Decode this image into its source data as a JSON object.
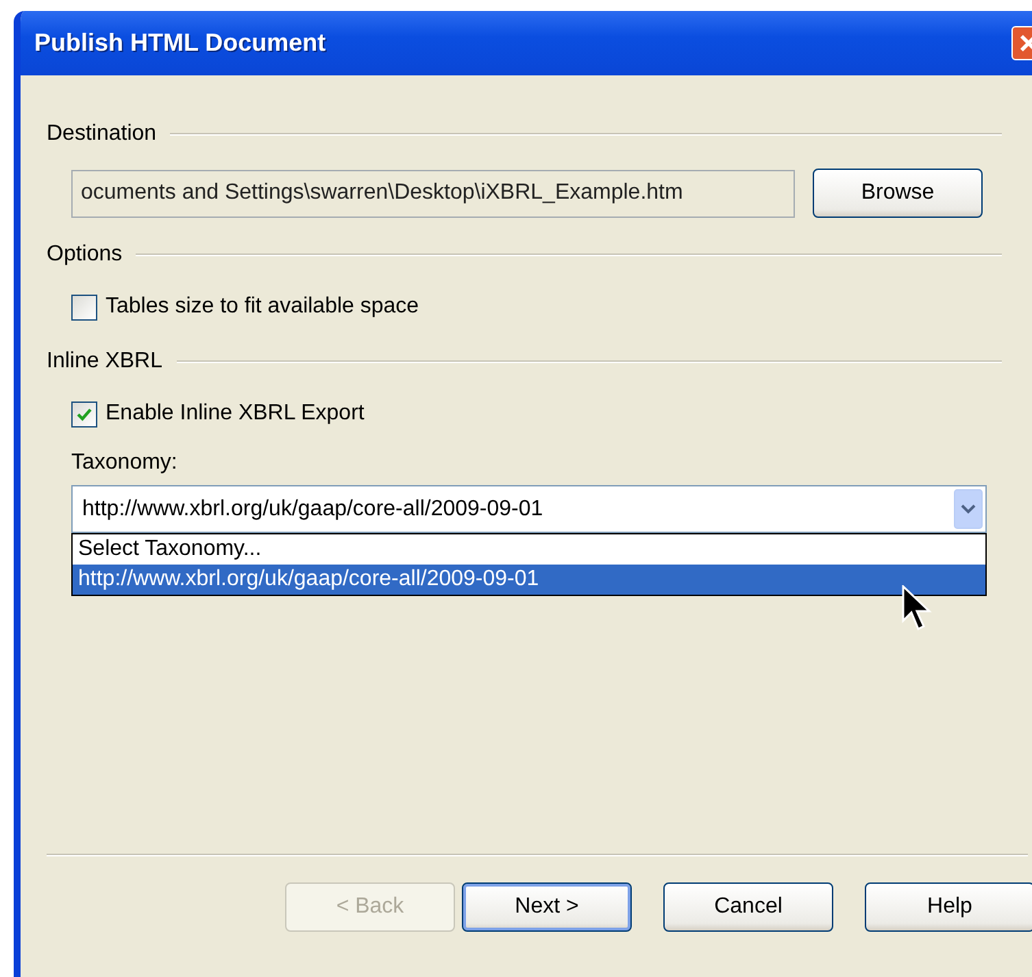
{
  "window": {
    "title": "Publish HTML Document"
  },
  "destination": {
    "label": "Destination",
    "path": "ocuments and Settings\\swarren\\Desktop\\iXBRL_Example.htm",
    "browse_button": "Browse"
  },
  "options": {
    "label": "Options",
    "checkboxes": [
      {
        "label": "Tables size to fit available space",
        "checked": false
      }
    ]
  },
  "inline_xbrl": {
    "label": "Inline XBRL",
    "checkboxes": [
      {
        "label": "Enable Inline XBRL Export",
        "checked": true
      }
    ],
    "taxonomy": {
      "label": "Taxonomy:",
      "value": "http://www.xbrl.org/uk/gaap/core-all/2009-09-01",
      "expanded": true,
      "options": [
        {
          "label": "Select Taxonomy...",
          "selected": false
        },
        {
          "label": "http://www.xbrl.org/uk/gaap/core-all/2009-09-01",
          "selected": true
        }
      ]
    }
  },
  "buttons": [
    {
      "label": "< Back",
      "disabled": true,
      "default": false
    },
    {
      "label": "Next >",
      "disabled": false,
      "default": true
    },
    {
      "label": "Cancel",
      "disabled": false,
      "default": false
    },
    {
      "label": "Help",
      "disabled": false,
      "default": false
    }
  ]
}
